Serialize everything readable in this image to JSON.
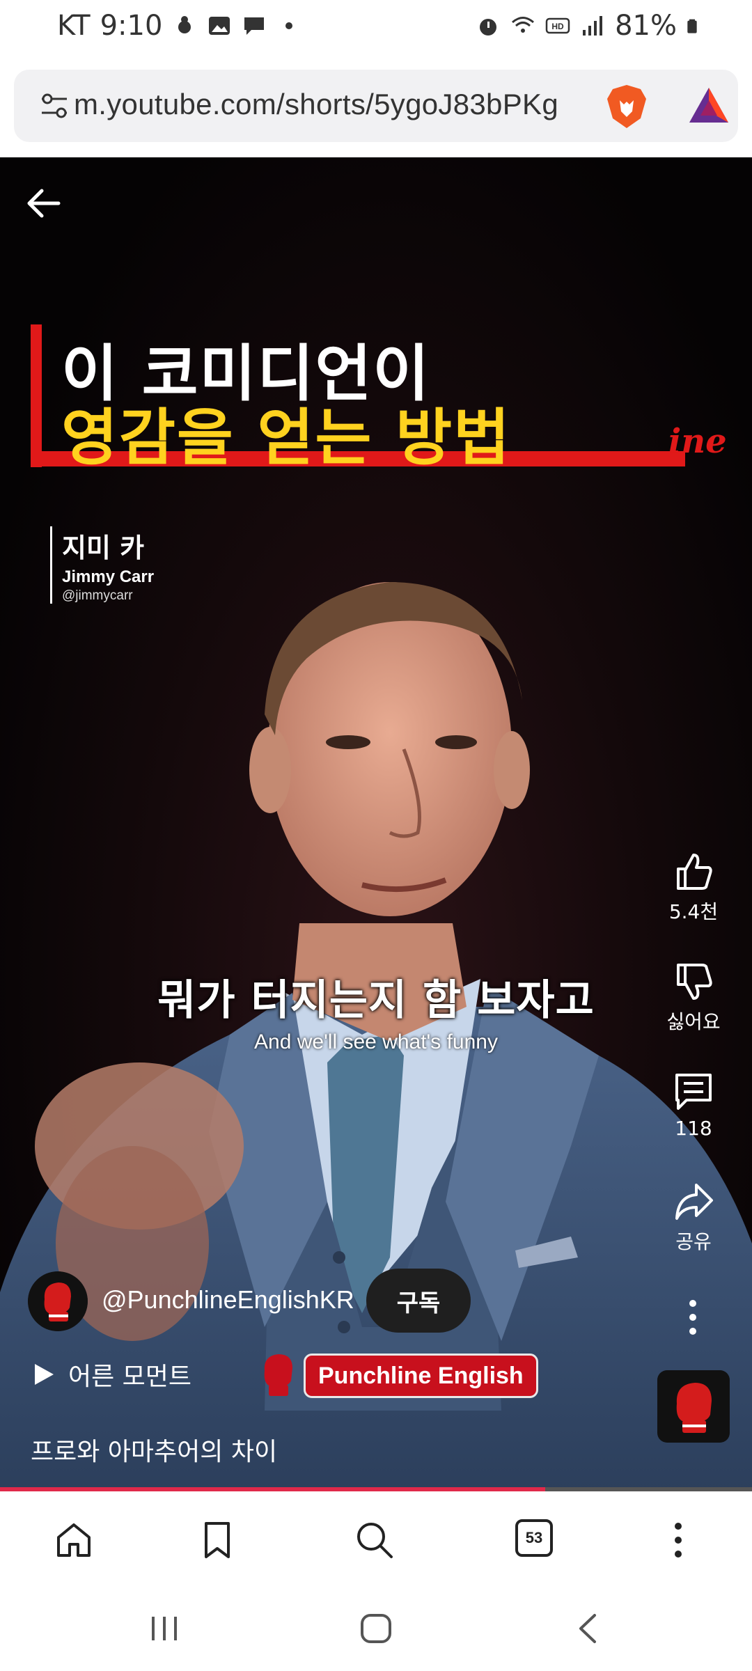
{
  "status_bar": {
    "carrier": "KT",
    "time": "9:10",
    "battery": "81%"
  },
  "browser": {
    "url": "m.youtube.com/shorts/5ygoJ83bPKg",
    "tabs_count": "53"
  },
  "video": {
    "title_line1": "이 코미디언이",
    "title_line2": "영감을 얻는 방법",
    "title_brand_tail": "ine",
    "speaker_ko": "지미 카",
    "speaker_en": "Jimmy Carr",
    "speaker_handle": "@jimmycarr",
    "subtitle_ko": "뭐가 터지는지 함 보자고",
    "subtitle_en": "And we'll see what's funny",
    "progress": 0.725
  },
  "actions": {
    "like_count": "5.4천",
    "dislike_label": "싫어요",
    "comment_count": "118",
    "share_label": "공유"
  },
  "channel": {
    "handle": "@PunchlineEnglishKR",
    "subscribe_label": "구독",
    "moment_label": "어른 모먼트",
    "brand_name": "Punchline English",
    "description": "프로와 아마추어의 차이"
  },
  "colors": {
    "accent_red": "#e01919",
    "title_yellow": "#ffd21f",
    "progress_fill": "#e0294a"
  }
}
